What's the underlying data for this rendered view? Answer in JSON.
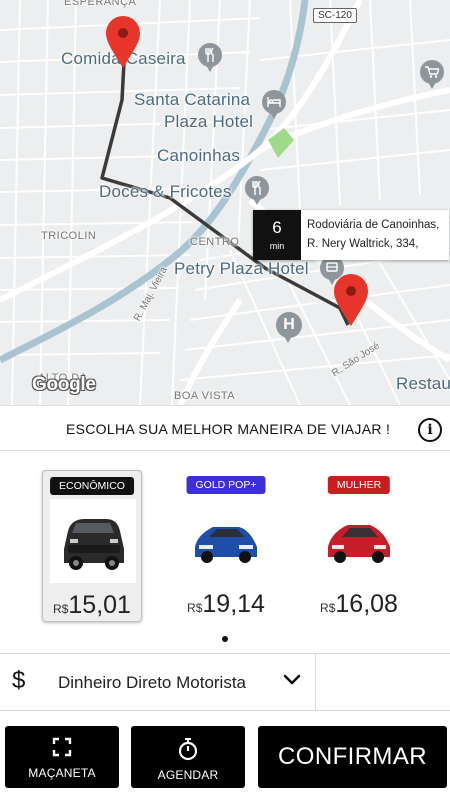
{
  "map": {
    "labels": {
      "esperanca": "ESPERANÇA",
      "comida_caseira": "Comida Caseira",
      "santa_catarina": "Santa Catarina",
      "plaza_hotel": "Plaza Hotel",
      "canoinhas": "Canoinhas",
      "doces_fricotes": "Doces & Fricotes",
      "tricolin": "TRICOLIN",
      "centro": "CENTRO",
      "petry_plaza": "Petry Plaza Hotel",
      "r_maj_vieira": "R. Maj. Vieira",
      "r_sao_jose": "R. São José",
      "alto_da_tijuca": "ALTO DA",
      "boa_vista": "BOA VISTA",
      "restau": "Restau",
      "road_badge": "SC-120"
    },
    "eta": {
      "minutes": "6",
      "unit": "min",
      "address_line1": "Rodoviária de Canoinhas,",
      "address_line2": "R. Nery Waltrick, 334,"
    },
    "google": "Google",
    "icons": [
      "restaurant-icon",
      "hotel-icon",
      "cart-icon",
      "hospital-icon",
      "pin-icon"
    ]
  },
  "header": {
    "title": "ESCOLHA SUA MELHOR MANEIRA DE VIAJAR !",
    "info_icon": "i"
  },
  "categories": [
    {
      "name": "ECONÔMICO",
      "currency": "R$",
      "price": "15,01",
      "badge_color": "#111111",
      "car_color": "#2a2a2a",
      "selected": true
    },
    {
      "name": "GOLD POP+",
      "currency": "R$",
      "price": "19,14",
      "badge_color": "#3c2fd6",
      "car_color": "#1d4fa8",
      "selected": false
    },
    {
      "name": "MULHER",
      "currency": "R$",
      "price": "16,08",
      "badge_color": "#c81e1e",
      "car_color": "#c61d2a",
      "selected": false
    }
  ],
  "payment": {
    "icon": "$",
    "method": "Dinheiro Direto Motorista"
  },
  "actions": {
    "macaneta": "MAÇANETA",
    "agendar": "AGENDAR",
    "confirmar": "CONFIRMAR"
  },
  "colors": {
    "pin": "#e8352b",
    "route": "#3a3a3a",
    "park": "#9fd98a"
  }
}
